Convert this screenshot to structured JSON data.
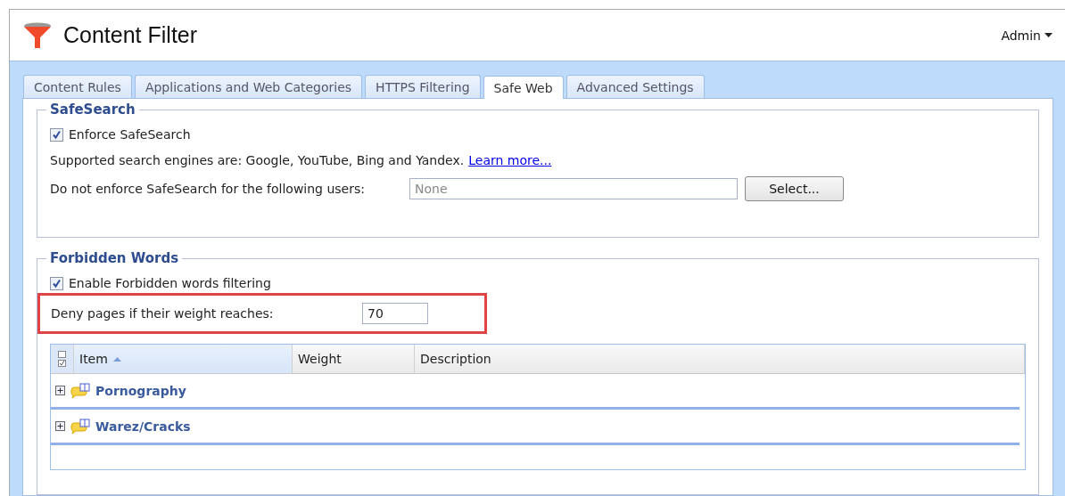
{
  "header": {
    "title": "Content Filter",
    "user_menu": "Admin"
  },
  "tabs": [
    {
      "label": "Content Rules",
      "selected": false
    },
    {
      "label": "Applications and Web Categories",
      "selected": false
    },
    {
      "label": "HTTPS Filtering",
      "selected": false
    },
    {
      "label": "Safe Web",
      "selected": true
    },
    {
      "label": "Advanced Settings",
      "selected": false
    }
  ],
  "safesearch": {
    "legend": "SafeSearch",
    "enforce": {
      "label": "Enforce SafeSearch",
      "checked": true
    },
    "info": "Supported search engines are: Google, YouTube, Bing and Yandex.",
    "link": "Learn more...",
    "exclude_label": "Do not enforce SafeSearch for the following users:",
    "exclude_field": {
      "placeholder": "None"
    },
    "select_button": "Select..."
  },
  "forbidden_words": {
    "legend": "Forbidden Words",
    "enable": {
      "label": "Enable Forbidden words filtering",
      "checked": true
    },
    "deny": {
      "label": "Deny pages if their weight reaches:",
      "value": "70",
      "highlighted": true
    },
    "table": {
      "columns": [
        {
          "label": "Item",
          "sorted": true
        },
        {
          "label": "Weight",
          "sorted": false
        },
        {
          "label": "Description",
          "sorted": false
        }
      ],
      "rows": [
        {
          "label": "Pornography",
          "expanded": false
        },
        {
          "label": "Warez/Cracks",
          "expanded": false
        }
      ]
    }
  }
}
